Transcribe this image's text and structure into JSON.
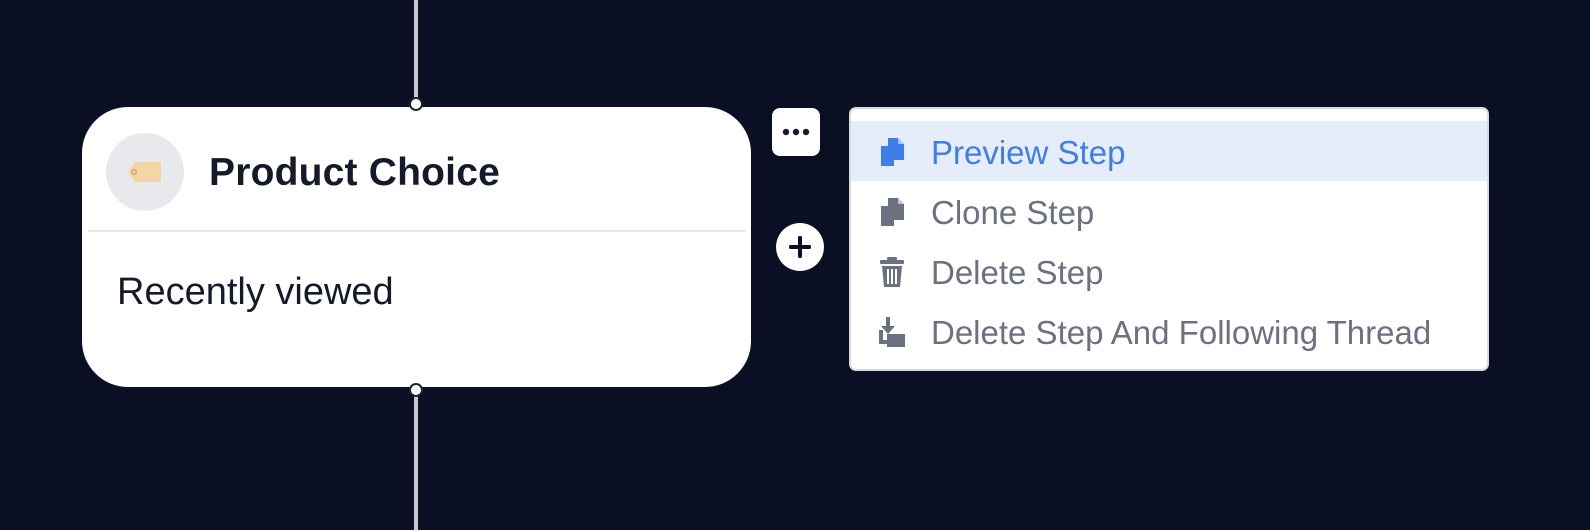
{
  "step": {
    "title": "Product Choice",
    "subtitle": "Recently viewed",
    "icon": "price-tag-icon"
  },
  "toolbar": {
    "more_icon": "more-horizontal-icon",
    "add_icon": "plus-icon"
  },
  "menu": {
    "items": [
      {
        "label": "Preview Step",
        "icon": "copy-doc-icon",
        "active": true
      },
      {
        "label": "Clone Step",
        "icon": "clone-icon",
        "active": false
      },
      {
        "label": "Delete Step",
        "icon": "trash-icon",
        "active": false
      },
      {
        "label": "Delete Step And Following Thread",
        "icon": "delete-thread-icon",
        "active": false
      }
    ]
  },
  "colors": {
    "background": "#0a0f24",
    "accent": "#3f7ee8",
    "menu_active_bg": "#e5edfb",
    "menu_text": "#6b7180"
  }
}
